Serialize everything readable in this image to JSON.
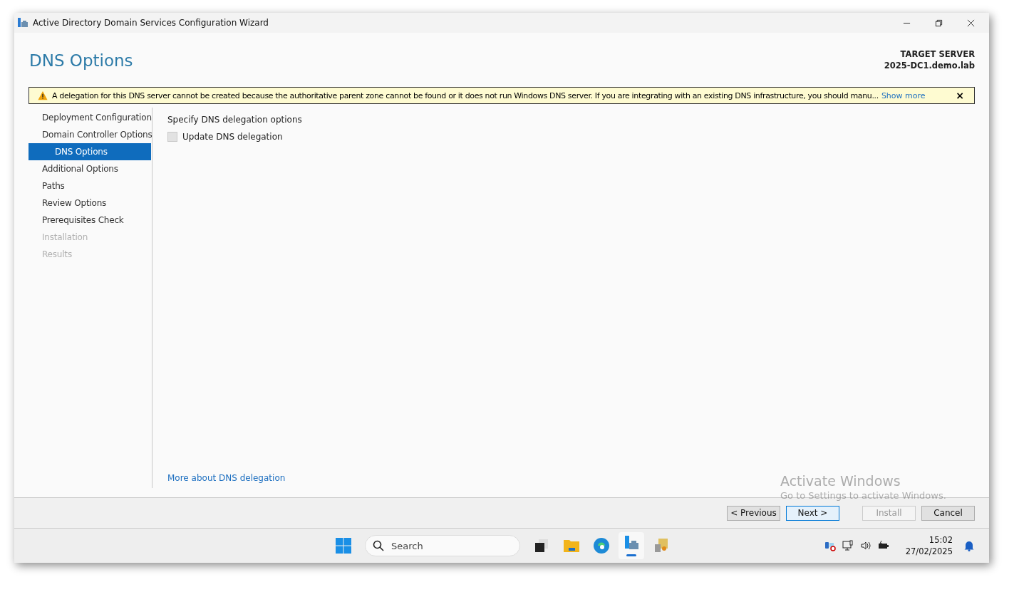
{
  "window": {
    "title": "Active Directory Domain Services Configuration Wizard"
  },
  "page_title": "DNS Options",
  "target_server": {
    "label": "TARGET SERVER",
    "name": "2025-DC1.demo.lab"
  },
  "warning": {
    "text": "A delegation for this DNS server cannot be created because the authoritative parent zone cannot be found or it does not run Windows DNS server. If you are integrating with an existing DNS infrastructure, you should manu...",
    "link": "Show more",
    "close": "×"
  },
  "sidebar": {
    "items": [
      {
        "label": "Deployment Configuration",
        "selected": false,
        "disabled": false
      },
      {
        "label": "Domain Controller Options",
        "selected": false,
        "disabled": false
      },
      {
        "label": "DNS Options",
        "selected": true,
        "disabled": false
      },
      {
        "label": "Additional Options",
        "selected": false,
        "disabled": false
      },
      {
        "label": "Paths",
        "selected": false,
        "disabled": false
      },
      {
        "label": "Review Options",
        "selected": false,
        "disabled": false
      },
      {
        "label": "Prerequisites Check",
        "selected": false,
        "disabled": false
      },
      {
        "label": "Installation",
        "selected": false,
        "disabled": true
      },
      {
        "label": "Results",
        "selected": false,
        "disabled": true
      }
    ]
  },
  "content": {
    "heading": "Specify DNS delegation options",
    "checkbox": {
      "label": "Update DNS delegation",
      "checked": false,
      "disabled": true
    },
    "help_link": "More about DNS delegation"
  },
  "buttons": [
    {
      "label": "< Previous",
      "disabled": false,
      "default": false
    },
    {
      "label": "Next >",
      "disabled": false,
      "default": true
    },
    {
      "label": "Install",
      "disabled": true,
      "default": false
    },
    {
      "label": "Cancel",
      "disabled": false,
      "default": false
    }
  ],
  "activation": {
    "title": "Activate Windows",
    "subtitle": "Go to Settings to activate Windows."
  },
  "taskbar": {
    "search_placeholder": "Search",
    "time": "15:02",
    "date": "27/02/2025"
  }
}
